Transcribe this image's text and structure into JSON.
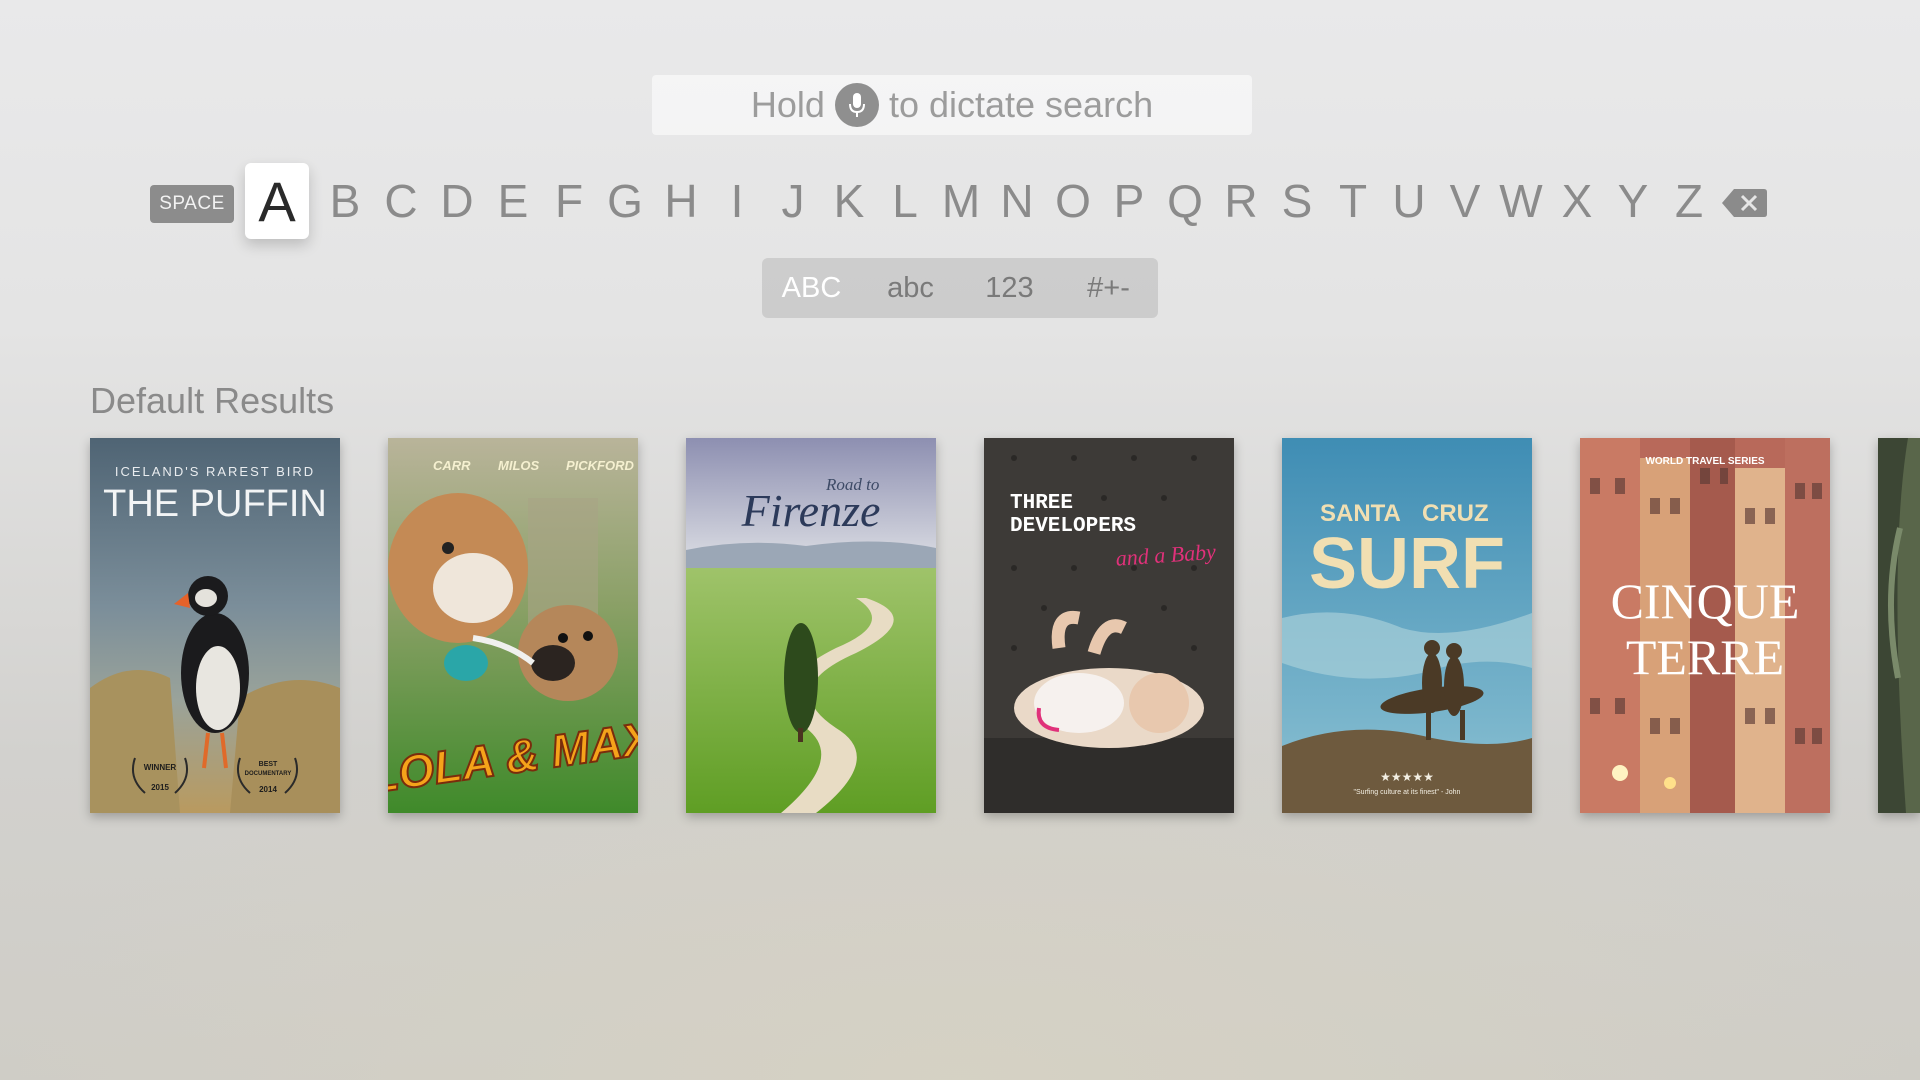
{
  "search": {
    "hint_before": "Hold",
    "hint_after": "to dictate search",
    "mic_icon": "microphone-icon"
  },
  "keyboard": {
    "space_label": "SPACE",
    "letters": [
      "A",
      "B",
      "C",
      "D",
      "E",
      "F",
      "G",
      "H",
      "I",
      "J",
      "K",
      "L",
      "M",
      "N",
      "O",
      "P",
      "Q",
      "R",
      "S",
      "T",
      "U",
      "V",
      "W",
      "X",
      "Y",
      "Z"
    ],
    "focused_letter": "A",
    "delete_icon": "delete-backspace-icon",
    "modes": [
      "ABC",
      "abc",
      "123",
      "#+-"
    ],
    "active_mode": "ABC"
  },
  "results": {
    "section_title": "Default Results",
    "posters": [
      {
        "kicker": "ICELAND'S RAREST BIRD",
        "title": "THE PUFFIN",
        "laurel_left": [
          "WINNER",
          "2015"
        ],
        "laurel_right": [
          "BEST",
          "DOCUMENTARY",
          "2014"
        ]
      },
      {
        "credits": [
          "CARR",
          "MILOS",
          "PICKFORD"
        ],
        "title": "LOLA & MAX"
      },
      {
        "title_small": "Road to",
        "title": "Firenze"
      },
      {
        "title_line1": "THREE",
        "title_line2": "DEVELOPERS",
        "subtitle": "and a Baby"
      },
      {
        "title_line1": "SANTA",
        "title_line1b": "CRUZ",
        "title": "SURF",
        "rating": "★★★★★",
        "quote": "\"Surfing culture at its finest\" - John"
      },
      {
        "series": "WORLD TRAVEL SERIES",
        "title_line1": "CINQUE",
        "title_line2": "TERRE"
      }
    ]
  },
  "colors": {
    "focused_key_bg": "#ffffff",
    "key_text": "#8b8b8b",
    "space_key_bg": "#8c8c8c"
  }
}
